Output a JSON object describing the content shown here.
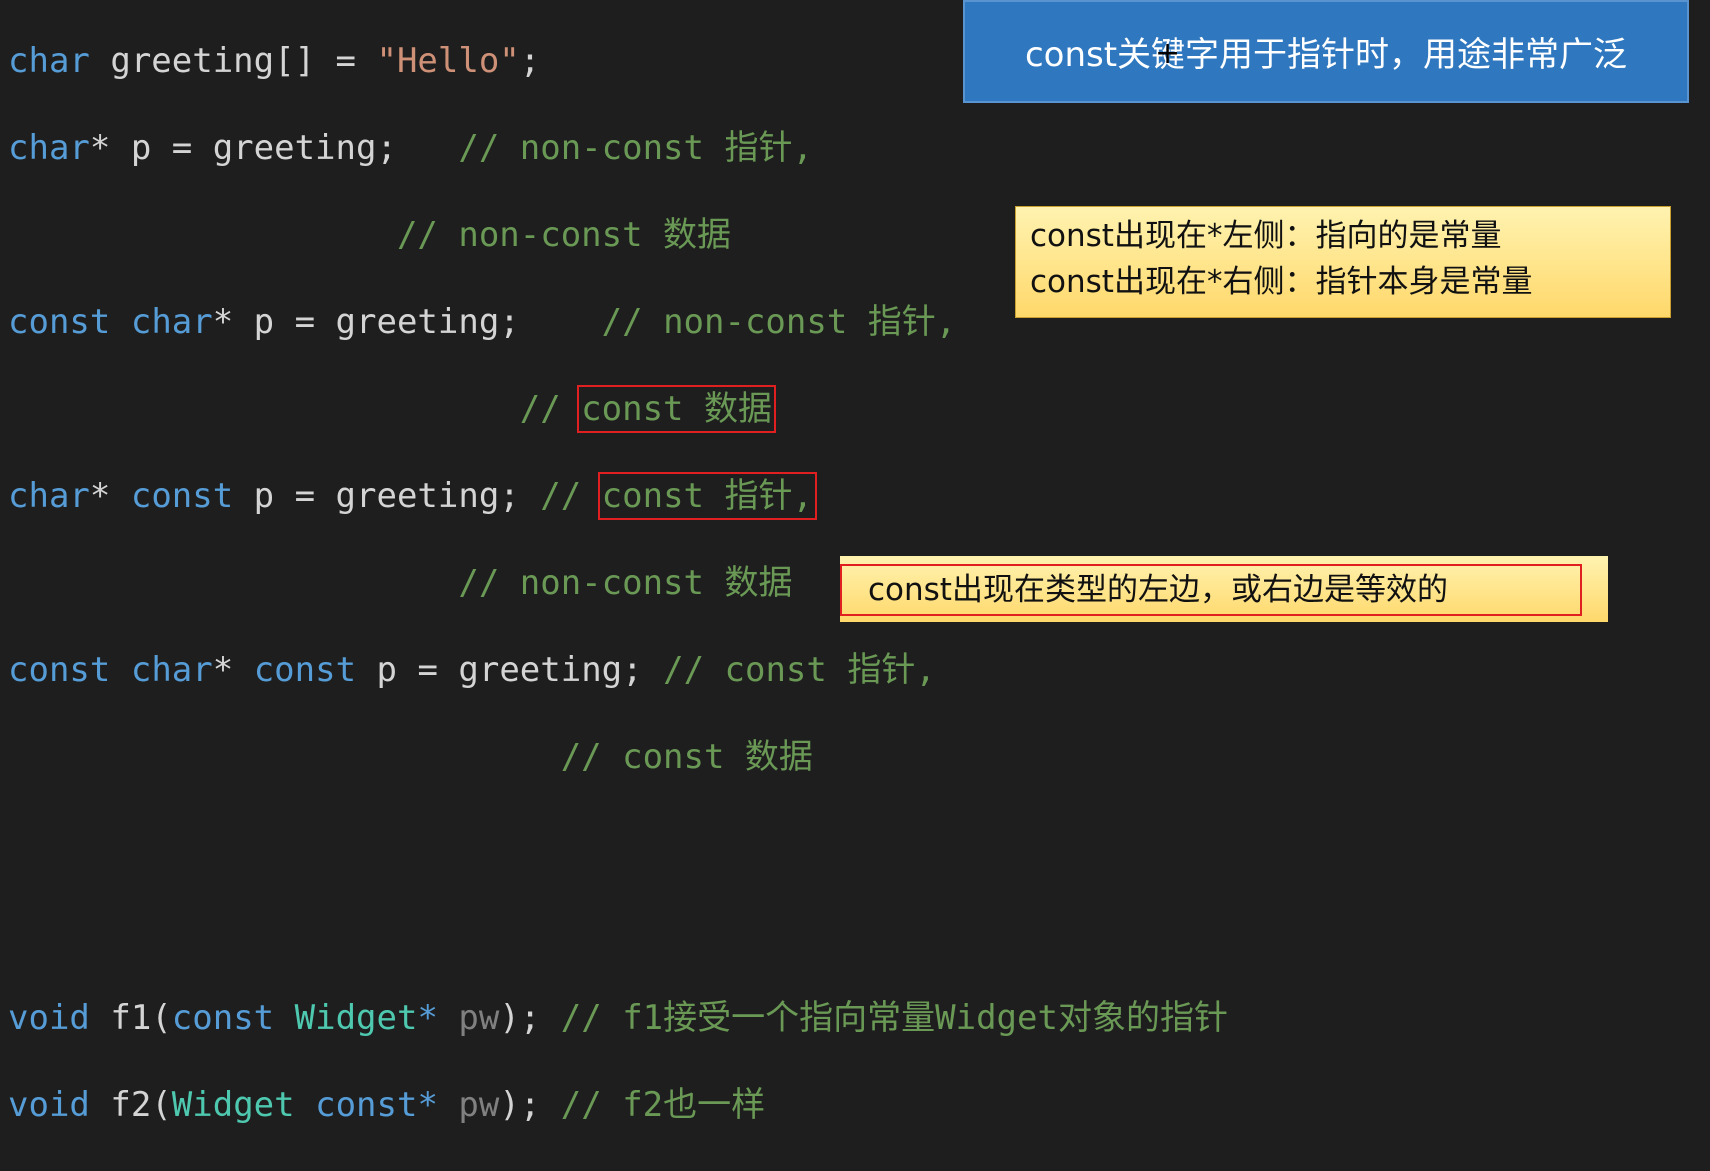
{
  "code": {
    "l1": {
      "kw": "char",
      "rest": " greeting[] = ",
      "str": "\"Hello\"",
      "end": ";"
    },
    "l2": {
      "kw": "char",
      "rest": "* p = greeting;   ",
      "cm": "// non-const 指针,"
    },
    "l3": {
      "pad": "                   ",
      "cm": "// non-const 数据"
    },
    "l4": {
      "kw1": "const",
      "sp": " ",
      "kw2": "char",
      "rest": "* p = greeting;    ",
      "cm": "// non-const 指针,"
    },
    "l5": {
      "pad": "                         ",
      "cm1": "// ",
      "cm2": "const 数据"
    },
    "l6": {
      "kw1": "char",
      "mid": "* ",
      "kw2": "const",
      "rest": " p = greeting; ",
      "cm1": "// ",
      "cm2": "const 指针,"
    },
    "l7": {
      "pad": "                      ",
      "cm": "// non-const 数据"
    },
    "l8": {
      "kw1": "const",
      "sp": " ",
      "kw2": "char",
      "mid": "* ",
      "kw3": "const",
      "rest": " p = greeting; ",
      "cm": "// const 指针,"
    },
    "l9": {
      "pad": "                           ",
      "cm": "// const 数据"
    },
    "l12": {
      "kw": "void",
      "a": " f1(",
      "kw2": "const",
      "sp": " ",
      "ty": "Widget",
      "star": "*",
      "sp2": " ",
      "pw": "pw",
      "b": "); ",
      "cm": "// f1接受一个指向常量Widget对象的指针"
    },
    "l13": {
      "kw": "void",
      "a": " f2(",
      "ty": "Widget",
      "sp": " ",
      "kw2": "const",
      "star": "*",
      "sp2": " ",
      "pw": "pw",
      "b": "); ",
      "cm": "// f2也一样"
    }
  },
  "notes": {
    "blue": "const关键字用于指针时，用途非常广泛",
    "cursor": "+",
    "yellow_line1": "const出现在*左侧：指向的是常量",
    "yellow_line2": "const出现在*右侧：指针本身是常量",
    "yellow2": "const出现在类型的左边，或右边是等效的"
  },
  "colors": {
    "background": "#1e1e1e",
    "keyword": "#569cd6",
    "string": "#ce9178",
    "comment": "#6a9955",
    "type": "#4ec9b0",
    "highlight": "#e02020"
  }
}
